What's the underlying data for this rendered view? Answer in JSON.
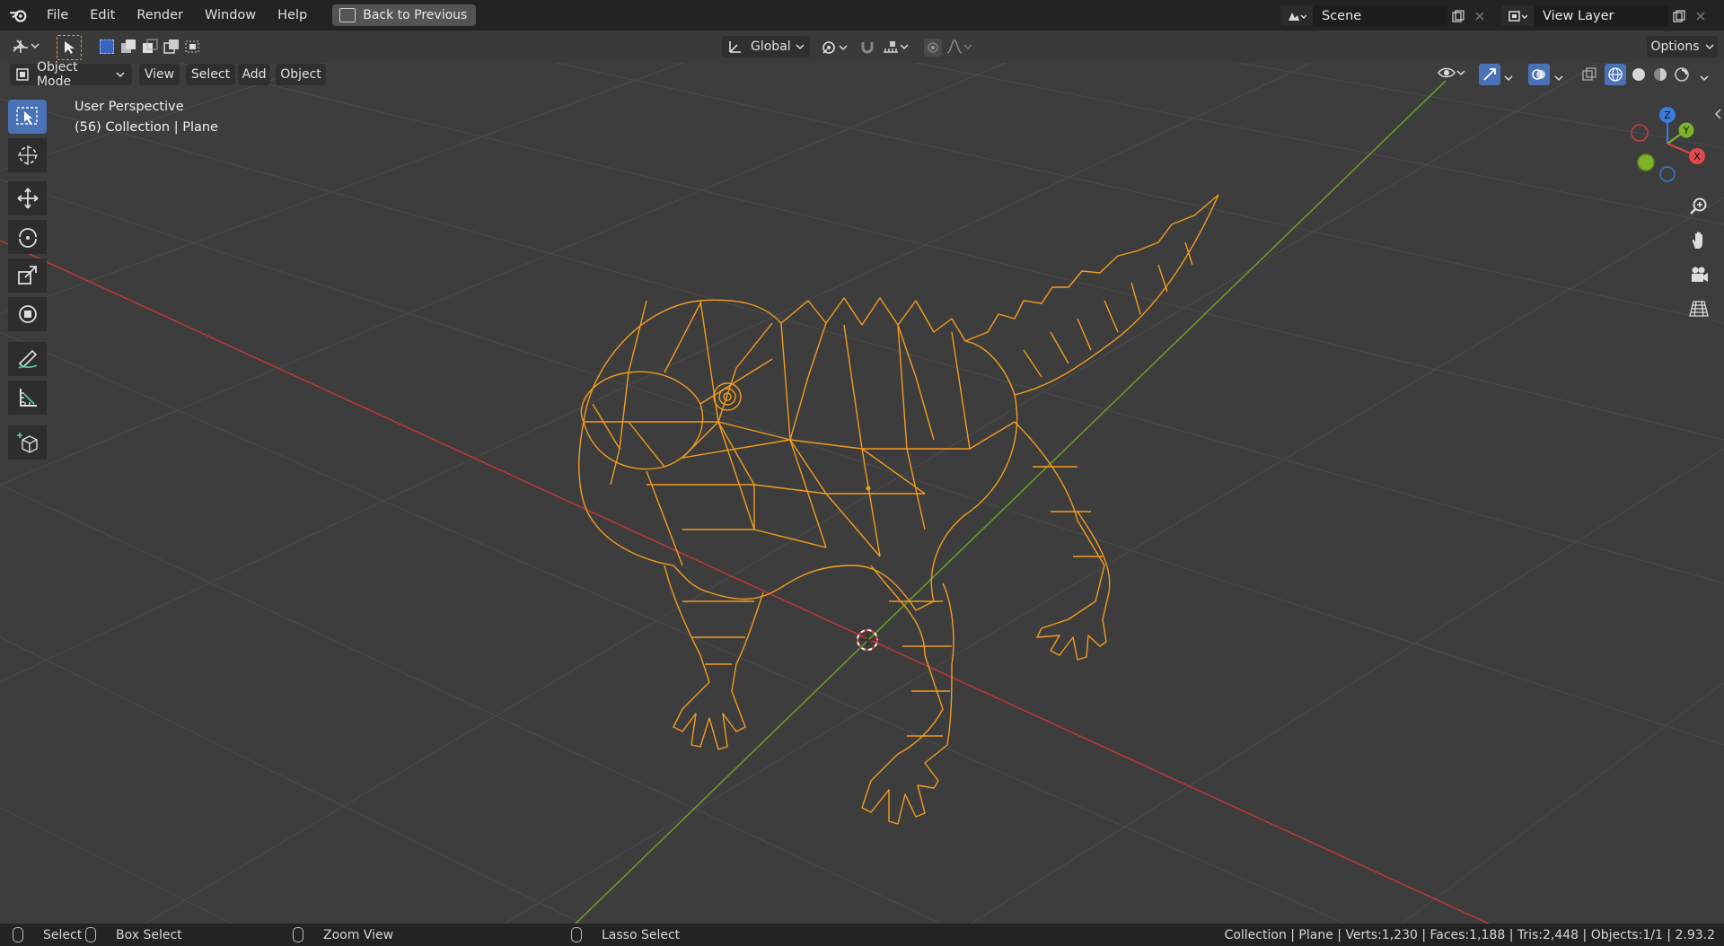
{
  "topbar": {
    "menu": [
      "File",
      "Edit",
      "Render",
      "Window",
      "Help"
    ],
    "back_label": "Back to Previous",
    "scene": "Scene",
    "view_layer": "View Layer"
  },
  "tool_header": {
    "orientation": "Global",
    "options": "Options"
  },
  "view_header": {
    "mode": "Object Mode",
    "menus": [
      "View",
      "Select",
      "Add",
      "Object"
    ]
  },
  "viewport": {
    "perspective": "User Perspective",
    "collection": "(56) Collection | Plane",
    "gizmo": {
      "x": "X",
      "y": "Y",
      "z": "Z"
    }
  },
  "statusbar": {
    "select": "Select",
    "box_select": "Box Select",
    "zoom_view": "Zoom View",
    "lasso_select": "Lasso Select",
    "stats": "Collection | Plane | Verts:1,230 | Faces:1,188 | Tris:2,448 | Objects:1/1 | 2.93.2"
  },
  "colors": {
    "wire": "#f39c1f",
    "x_axis": "#b83a3a",
    "y_axis": "#6a9a2a",
    "active_tool": "#4a72b7"
  }
}
